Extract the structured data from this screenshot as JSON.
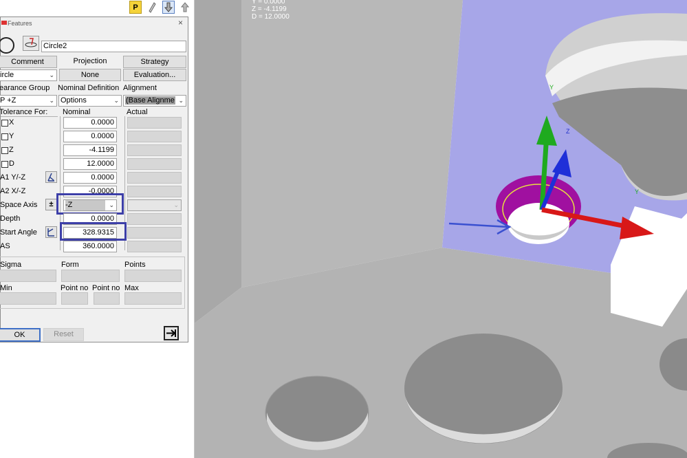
{
  "readout": {
    "y": "Y =      0.0000",
    "z": "Z =    -4.1199",
    "d": "D =    12.0000"
  },
  "toolbar": {
    "p_label": "P"
  },
  "dialog": {
    "title": "Features",
    "close": "×",
    "feature_name": "Circle2",
    "tabs": {
      "comment": "Comment",
      "projection": "Projection",
      "strategy": "Strategy"
    },
    "row2": {
      "type_value": "ircle",
      "none": "None",
      "evaluation": "Evaluation..."
    },
    "row3": {
      "clearance_group": "earance Group",
      "nominal_definition": "Nominal Definition",
      "alignment": "Alignment"
    },
    "row4": {
      "plane_value": "P +Z",
      "options": "Options",
      "base_alignment": "(Base Alignme"
    },
    "headers": {
      "tolerance_for": "Tolerance For:",
      "nominal": "Nominal",
      "actual": "Actual"
    },
    "params": [
      {
        "label": "X",
        "value": "0.0000"
      },
      {
        "label": "Y",
        "value": "0.0000"
      },
      {
        "label": "Z",
        "value": "-4.1199"
      },
      {
        "label": "D",
        "value": "12.0000"
      },
      {
        "label": "A1 Y/-Z",
        "value": "0.0000"
      },
      {
        "label": "A2 X/-Z",
        "value": "-0.0000"
      }
    ],
    "space_axis": {
      "label": "Space Axis",
      "sign": "±",
      "value": "-Z"
    },
    "depth": {
      "label": "Depth",
      "value": "0.0000"
    },
    "start_angle": {
      "label": "Start Angle",
      "value": "328.9315"
    },
    "as": {
      "label": "AS",
      "value": "360.0000"
    },
    "stats1": {
      "sigma": "Sigma",
      "form": "Form",
      "points": "Points"
    },
    "stats2": {
      "min": "Min",
      "point_no_1": "Point no",
      "point_no_2": "Point no",
      "max": "Max"
    },
    "ok": "OK",
    "reset": "Reset",
    "next_icon": "arrow-right-icon"
  },
  "viewport": {
    "axis_labels": {
      "y": "Y",
      "z": "Z",
      "y2": "Y",
      "circle": "Circle2"
    },
    "colors": {
      "face_blue": "#a7a6e8",
      "axis_x": "#d81818",
      "axis_y": "#1faa1f",
      "axis_z": "#1f2fd8",
      "torus": "#a010a0"
    }
  }
}
